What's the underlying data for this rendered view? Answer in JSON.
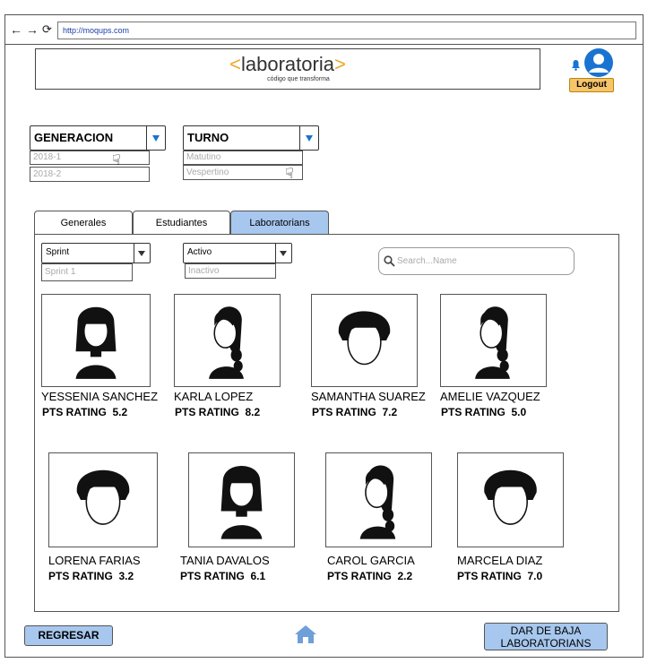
{
  "browser": {
    "url": "http://moqups.com",
    "back_icon": "arrow-left-icon",
    "forward_icon": "arrow-right-icon",
    "reload_icon": "reload-icon"
  },
  "header": {
    "logo_text": "laboratoria",
    "logo_open": "<",
    "logo_close": ">",
    "logo_tagline": "código que transforma",
    "logout_label": "Logout",
    "notification_icon": "bell-icon",
    "avatar_icon": "user-icon"
  },
  "filters": {
    "generacion": {
      "label": "GENERACION",
      "options": [
        "2018-1",
        "2018-2"
      ]
    },
    "turno": {
      "label": "TURNO",
      "options": [
        "Matutino",
        "Vespertino"
      ]
    }
  },
  "tabs": [
    {
      "label": "Generales",
      "active": false
    },
    {
      "label": "Estudiantes",
      "active": false
    },
    {
      "label": "Laboratorians",
      "active": true
    }
  ],
  "panel": {
    "sprint": {
      "label": "Sprint",
      "option": "Sprint 1"
    },
    "estado": {
      "label": "Activo",
      "option": "Inactivo"
    },
    "search_placeholder": "Search...Name"
  },
  "students": [
    {
      "name": "YESSENIA SANCHEZ",
      "rating_label": "PTS RATING",
      "rating": "5.2",
      "hair": "bob"
    },
    {
      "name": "KARLA LOPEZ",
      "rating_label": "PTS RATING",
      "rating": "8.2",
      "hair": "braid"
    },
    {
      "name": "SAMANTHA SUAREZ",
      "rating_label": "PTS RATING",
      "rating": "7.2",
      "hair": "short"
    },
    {
      "name": "AMELIE VAZQUEZ",
      "rating_label": "PTS RATING",
      "rating": "5.0",
      "hair": "braid"
    },
    {
      "name": "LORENA FARIAS",
      "rating_label": "PTS RATING",
      "rating": "3.2",
      "hair": "short"
    },
    {
      "name": "TANIA DAVALOS",
      "rating_label": "PTS RATING",
      "rating": "6.1",
      "hair": "bob"
    },
    {
      "name": "CAROL GARCIA",
      "rating_label": "PTS RATING",
      "rating": "2.2",
      "hair": "braid"
    },
    {
      "name": "MARCELA DIAZ",
      "rating_label": "PTS RATING",
      "rating": "7.0",
      "hair": "short"
    }
  ],
  "footer": {
    "back_label": "REGRESAR",
    "home_icon": "home-icon",
    "remove_label_line1": "DAR DE BAJA",
    "remove_label_line2": "LABORATORIANS"
  },
  "colors": {
    "accent_blue": "#a7c7ee",
    "avatar_blue": "#1a73d0",
    "logout_orange": "#f6c46b",
    "logo_bracket": "#f0a52a"
  }
}
